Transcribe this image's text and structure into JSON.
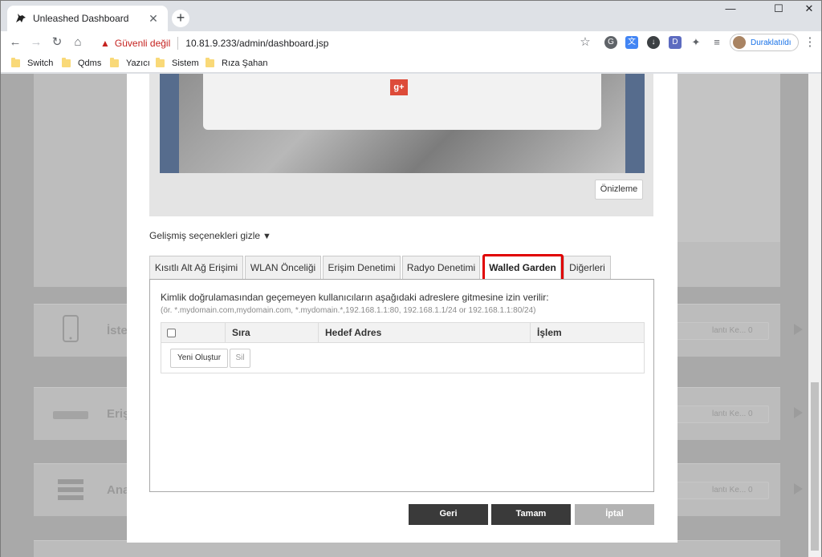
{
  "browser": {
    "tab_title": "Unleashed Dashboard",
    "security_label": "Güvenli değil",
    "url": "10.81.9.233/admin/dashboard.jsp",
    "profile_label": "Duraklatıldı",
    "extension_d_label": "D",
    "bookmarks": [
      "Switch",
      "Qdms",
      "Yazıcı",
      "Sistem",
      "Rıza Şahan"
    ]
  },
  "background": {
    "cards": [
      {
        "label": "İste",
        "pill": "lantı Ke...  0"
      },
      {
        "label": "Eriş",
        "pill": "lantı Ke...  0"
      },
      {
        "label": "Ana",
        "pill": "lantı Ke...  0"
      }
    ]
  },
  "modal": {
    "preview_button": "Önizleme",
    "gplus_label": "g+",
    "advanced_toggle": "Gelişmiş seçenekleri gizle",
    "tabs": [
      {
        "label": "Kısıtlı Alt Ağ Erişimi",
        "active": false
      },
      {
        "label": "WLAN Önceliği",
        "active": false
      },
      {
        "label": "Erişim Denetimi",
        "active": false
      },
      {
        "label": "Radyo Denetimi",
        "active": false
      },
      {
        "label": "Walled Garden",
        "active": true
      },
      {
        "label": "Diğerleri",
        "active": false
      }
    ],
    "walled_garden": {
      "description": "Kimlik doğrulamasından geçemeyen kullanıcıların aşağıdaki adreslere gitmesine izin verilir:",
      "example": "(ör. *.mydomain.com,mydomain.com, *.mydomain.*,192.168.1.1:80, 192.168.1.1/24 or 192.168.1.1:80/24)",
      "columns": [
        "Sıra",
        "Hedef Adres",
        "İşlem"
      ],
      "create_button": "Yeni Oluştur",
      "delete_button": "Sil"
    },
    "footer": {
      "back": "Geri",
      "ok": "Tamam",
      "cancel": "İptal"
    }
  },
  "colors": {
    "highlight": "#e00000",
    "primary_button": "#3a3a3a",
    "disabled_button": "#b3b3b3"
  }
}
